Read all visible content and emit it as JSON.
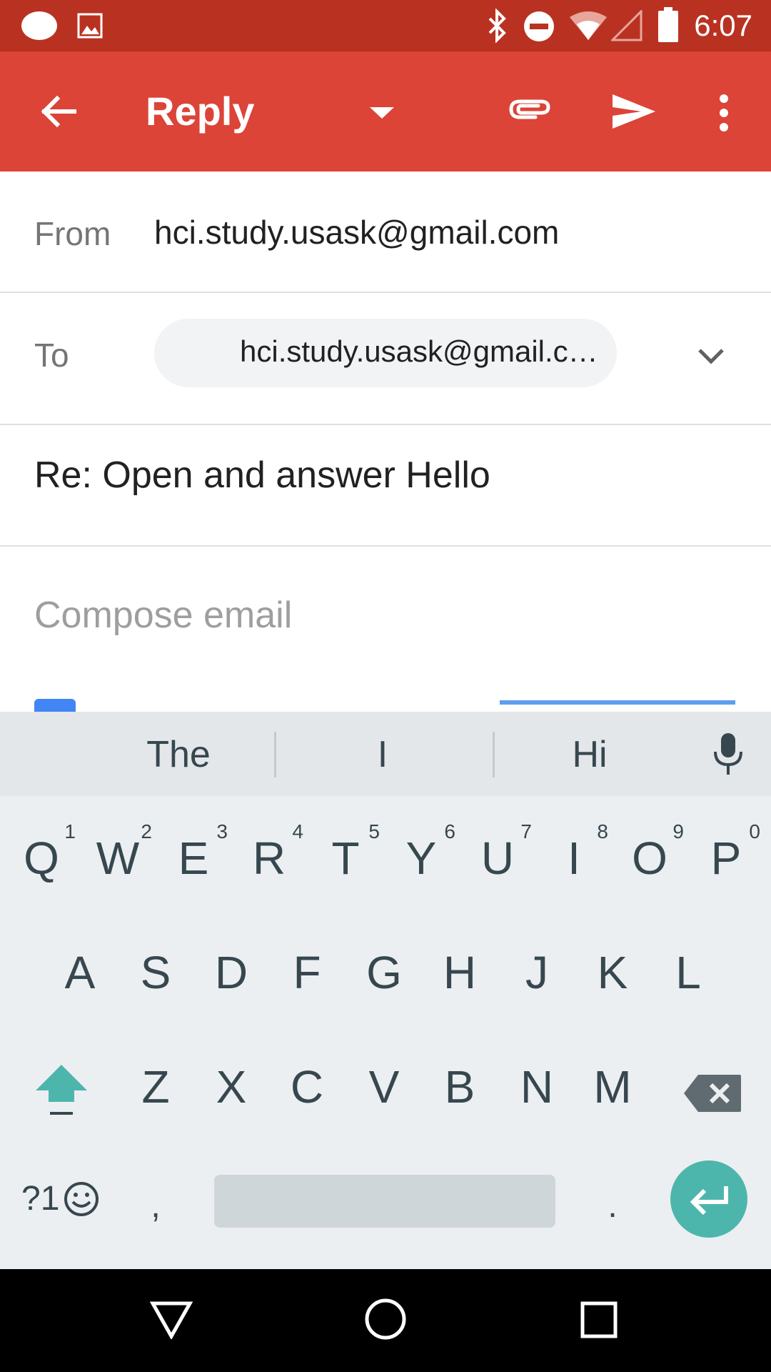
{
  "status_bar": {
    "time": "6:07",
    "icons": [
      "notification-icon",
      "image-icon",
      "bluetooth-icon",
      "do-not-disturb-icon",
      "wifi-icon",
      "signal-icon",
      "battery-icon"
    ]
  },
  "app_bar": {
    "title": "Reply",
    "icons": [
      "back-arrow-icon",
      "dropdown-icon",
      "attach-icon",
      "send-icon",
      "more-vert-icon"
    ]
  },
  "compose": {
    "from_label": "From",
    "from_value": "hci.study.usask@gmail.com",
    "to_label": "To",
    "to_chip": "hci.study.usask@gmail.c…",
    "subject": "Re: Open and answer Hello",
    "body_placeholder": "Compose email"
  },
  "keyboard": {
    "suggestions": [
      "The",
      "I",
      "Hi"
    ],
    "row1": [
      "Q",
      "W",
      "E",
      "R",
      "T",
      "Y",
      "U",
      "I",
      "O",
      "P"
    ],
    "row1_hints": [
      "1",
      "2",
      "3",
      "4",
      "5",
      "6",
      "7",
      "8",
      "9",
      "0"
    ],
    "row2": [
      "A",
      "S",
      "D",
      "F",
      "G",
      "H",
      "J",
      "K",
      "L"
    ],
    "row3": [
      "Z",
      "X",
      "C",
      "V",
      "B",
      "N",
      "M"
    ],
    "symbols_label": "?1",
    "comma": ",",
    "period": ".",
    "accent_color": "#4db6ac"
  },
  "colors": {
    "status_bar": "#b93221",
    "app_bar": "#db4437"
  }
}
